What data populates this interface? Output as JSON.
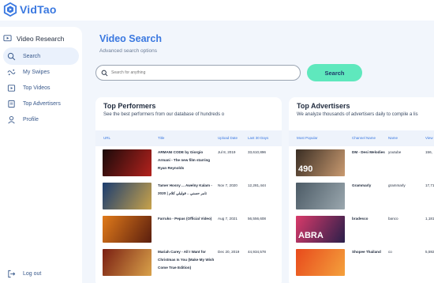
{
  "brand": {
    "name": "VidTao",
    "color": "#3a78e0"
  },
  "sidebar": {
    "header": "Video Research",
    "items": [
      {
        "label": "Search",
        "icon": "search-icon",
        "active": true
      },
      {
        "label": "My Swipes",
        "icon": "swipes-icon"
      },
      {
        "label": "Top Videos",
        "icon": "video-icon"
      },
      {
        "label": "Top Advertisers",
        "icon": "advertiser-icon"
      },
      {
        "label": "Profile",
        "icon": "user-icon"
      }
    ],
    "logout": "Log out"
  },
  "main": {
    "title": "Video Search",
    "subtitle": "Advanced search options",
    "search": {
      "placeholder": "Search for anything",
      "value": ""
    },
    "search_button": "Search"
  },
  "top_performers": {
    "title": "Top Performers",
    "subtitle": "See the best performers from our database of hundreds o",
    "columns": [
      "URL",
      "Title",
      "Upload Date",
      "Last 30 Days"
    ],
    "rows": [
      {
        "title": "ARMANI CODE by Giorgio Armani - The new film starring Ryan Reynolds",
        "date": "Jul 8, 2019",
        "views": "33,610,896",
        "thumb": [
          "#1a0a0a",
          "#b3221d"
        ]
      },
      {
        "title": "Tamer Hosny ... Awelny Kalam - 2020 | تامر حسني .. قوليلي كلام",
        "date": "Nov 7, 2020",
        "views": "12,281,444",
        "thumb": [
          "#1c3d70",
          "#c8a24a"
        ]
      },
      {
        "title": "Farruko - Pepas (Official Video)",
        "date": "Aug 7, 2021",
        "views": "56,556,608",
        "thumb": [
          "#e07a1a",
          "#5a1e0e"
        ]
      },
      {
        "title": "Mariah Carey - All I Want for Christmas Is You (Make My Wish Come True Edition)",
        "date": "Dec 20, 2019",
        "views": "44,934,578",
        "thumb": [
          "#7a1f12",
          "#d9a24a"
        ]
      }
    ]
  },
  "top_advertisers": {
    "title": "Top Advertisers",
    "subtitle": "We analyze thousands of advertisers daily to compile a lis",
    "columns": [
      "Most Popular",
      "Channel Name",
      "Name",
      "View"
    ],
    "rows": [
      {
        "channel": "DM - Desi Melodies",
        "name": "youtube",
        "views": "156,",
        "thumb": [
          "#3a2e24",
          "#c99a70"
        ],
        "overlay": "490"
      },
      {
        "channel": "Grammarly",
        "name": "grammarly",
        "views": "17,71",
        "thumb": [
          "#4c5b66",
          "#9aa7ae"
        ],
        "overlay": ""
      },
      {
        "channel": "bradesco",
        "name": "banco",
        "views": "1,181",
        "thumb": [
          "#d93a6a",
          "#2a1f4a"
        ],
        "overlay": "ABRA"
      },
      {
        "channel": "Shopee Thailand",
        "name": "co",
        "views": "5,592",
        "thumb": [
          "#e84a1c",
          "#f4a13c"
        ],
        "overlay": ""
      }
    ]
  }
}
